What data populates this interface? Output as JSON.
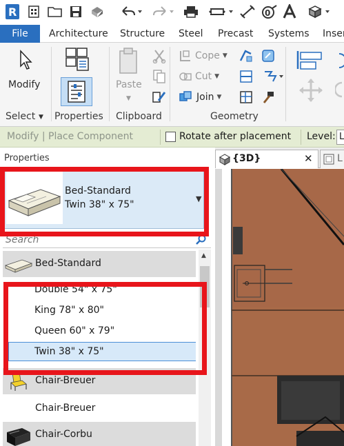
{
  "app": {
    "logo_letter": "R",
    "brand_color": "#2a6fbf",
    "highlight_color": "#e8151b"
  },
  "quick_access": {
    "icons": [
      "revit-logo-icon",
      "home-icon",
      "open-folder-icon",
      "save-icon",
      "sync-icon",
      "undo-icon",
      "redo-icon",
      "print-icon",
      "measure-icon",
      "aligned-dimension-icon",
      "tag-icon",
      "text-icon",
      "3d-view-icon"
    ]
  },
  "ribbon_tabs": [
    "File",
    "Architecture",
    "Structure",
    "Steel",
    "Precast",
    "Systems",
    "Inser"
  ],
  "ribbon": {
    "select_panel": {
      "button": "Modify",
      "title": "Select"
    },
    "properties_panel": {
      "button": "Properties",
      "title": "Properties"
    },
    "clipboard_panel": {
      "paste": "Paste",
      "title": "Clipboard"
    },
    "geometry_panel": {
      "cope": "Cope",
      "cut": "Cut",
      "join": "Join",
      "title": "Geometry"
    }
  },
  "options_bar": {
    "mode": "Modify | Place Component",
    "rotate_label": "Rotate after placement",
    "rotate_checked": false,
    "level_label": "Level:",
    "level_value": "L"
  },
  "properties": {
    "title": "Properties",
    "family": "Bed-Standard",
    "type": "Twin 38\" x 75\"",
    "search_placeholder": "Search",
    "list": [
      {
        "kind": "family",
        "label": "Bed-Standard",
        "icon": "bed-thumbnail-icon"
      },
      {
        "kind": "type",
        "label": "Double 54\" x 75\""
      },
      {
        "kind": "type",
        "label": "King 78\" x 80\""
      },
      {
        "kind": "type",
        "label": "Queen 60\" x 79\""
      },
      {
        "kind": "type",
        "label": "Twin 38\" x 75\"",
        "selected": true
      },
      {
        "kind": "family",
        "label": "Chair-Breuer",
        "icon": "chair-breuer-thumbnail-icon"
      },
      {
        "kind": "type",
        "label": "Chair-Breuer"
      },
      {
        "kind": "family",
        "label": "Chair-Corbu",
        "icon": "chair-corbu-thumbnail-icon"
      }
    ]
  },
  "view_tabs": [
    {
      "label": "{3D}",
      "active": true
    },
    {
      "label": "L",
      "active": false
    }
  ],
  "colors": {
    "floor_wood": "#a86a48",
    "floor_wood_dark": "#8e5538",
    "options_bar_bg": "#e4ecd3",
    "selection_blue": "#d7e9f9"
  }
}
